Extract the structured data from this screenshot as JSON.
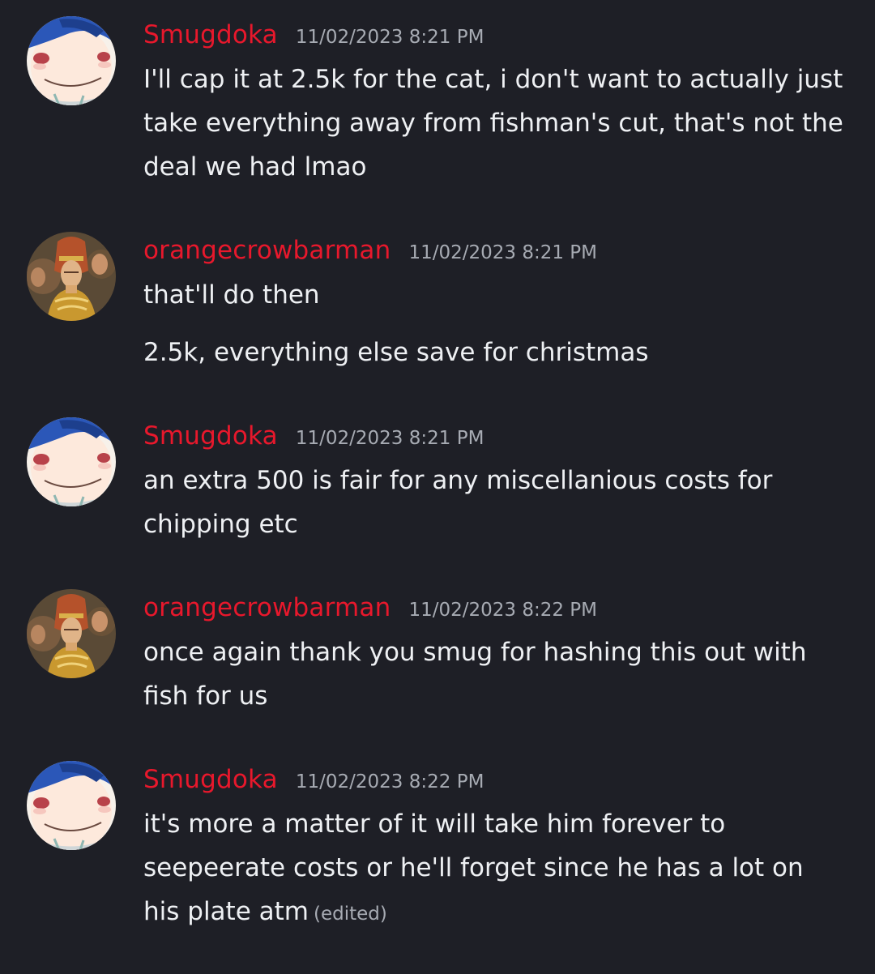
{
  "messages": [
    {
      "author": "Smugdoka",
      "timestamp": "11/02/2023 8:21 PM",
      "lines": [
        "I'll cap it at 2.5k for the cat, i don't want to actually just",
        "take everything away from fishman's cut, that's not the",
        "deal we had lmao"
      ]
    },
    {
      "author": "orangecrowbarman",
      "timestamp": "11/02/2023 8:21 PM",
      "lines": [
        "that'll do then",
        "2.5k, everything else save for christmas"
      ]
    },
    {
      "author": "Smugdoka",
      "timestamp": "11/02/2023 8:21 PM",
      "lines": [
        "an extra 500 is fair for any miscellanious costs for",
        "chipping etc"
      ]
    },
    {
      "author": "orangecrowbarman",
      "timestamp": "11/02/2023 8:22 PM",
      "lines": [
        "once again thank you smug for hashing this out with",
        "fish for us"
      ]
    },
    {
      "author": "Smugdoka",
      "timestamp": "11/02/2023 8:22 PM",
      "lines": [
        "it's more a matter of it will take him forever to",
        "seepeerate costs or he'll forget since he has a lot on",
        "his plate atm"
      ],
      "edited_label": "(edited)"
    }
  ],
  "colors": {
    "background": "#1e1f26",
    "username": "#e8182c",
    "timestamp": "#a7abb3",
    "message_text": "#eef0f3"
  },
  "avatars": {
    "smugdoka": "anime-character-blue-hat-avatar",
    "orangecrowbarman": "pharaoh-painting-avatar"
  }
}
